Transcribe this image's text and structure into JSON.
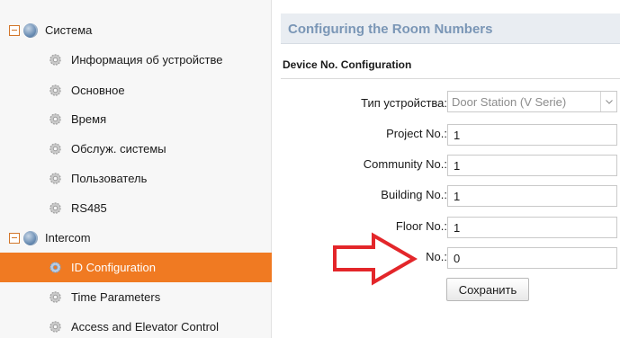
{
  "sidebar": {
    "groups": [
      {
        "label": "Система"
      },
      {
        "label": "Intercom"
      }
    ],
    "items": [
      {
        "label": "Информация об устройстве"
      },
      {
        "label": "Основное"
      },
      {
        "label": "Время"
      },
      {
        "label": "Обслуж. системы"
      },
      {
        "label": "Пользователь"
      },
      {
        "label": "RS485"
      },
      {
        "label": "ID Configuration",
        "selected": true
      },
      {
        "label": "Time Parameters"
      },
      {
        "label": "Access and Elevator Control"
      }
    ]
  },
  "main": {
    "title": "Configuring the Room Numbers",
    "section_title": "Device No. Configuration",
    "form": {
      "device_type_label": "Тип устройства:",
      "device_type_value": "Door Station (V Serie)",
      "project_label": "Project No.:",
      "project_value": "1",
      "community_label": "Community No.:",
      "community_value": "1",
      "building_label": "Building No.:",
      "building_value": "1",
      "floor_label": "Floor No.:",
      "floor_value": "1",
      "no_label": "No.:",
      "no_value": "0"
    },
    "save_label": "Сохранить"
  },
  "colors": {
    "selected_bg": "#f07a22",
    "header_bg": "#e9edf2",
    "header_text": "#7a96b6",
    "annotation_arrow": "#e3262a"
  }
}
